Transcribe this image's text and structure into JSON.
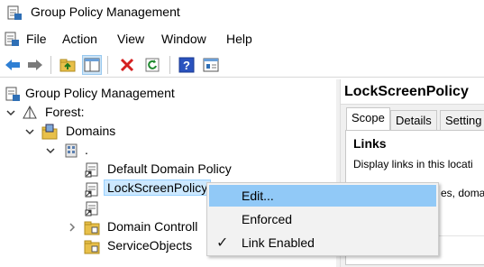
{
  "window": {
    "title": "Group Policy Management"
  },
  "menu": [
    "File",
    "Action",
    "View",
    "Window",
    "Help"
  ],
  "toolbar": {
    "buttons": [
      "back-icon",
      "forward-icon",
      "up-folder-icon",
      "show-hide-tree-icon",
      "delete-icon",
      "refresh-icon",
      "help-icon",
      "properties-icon"
    ]
  },
  "tree": {
    "root": "Group Policy Management",
    "forest": "Forest:",
    "domains": "Domains",
    "domain": ".",
    "gpo1": "Default Domain Policy",
    "gpo2": "LockScreenPolicy",
    "gpo3": "",
    "ou1": "Domain Controll",
    "ou2": "ServiceObjects"
  },
  "details": {
    "header": "LockScreenPolicy",
    "tabs": [
      "Scope",
      "Details",
      "Setting"
    ],
    "active_tab": "Scope",
    "section": "Links",
    "description": "Display links in this locati",
    "fragment": "es, doma"
  },
  "context_menu": {
    "items": [
      {
        "label": "Edit...",
        "highlighted": true,
        "checked": false
      },
      {
        "label": "Enforced",
        "highlighted": false,
        "checked": false
      },
      {
        "label": "Link Enabled",
        "highlighted": false,
        "checked": true
      }
    ],
    "check_glyph": "✓"
  },
  "colors": {
    "selection": "#cce8ff",
    "menu_highlight": "#91c9f7"
  }
}
